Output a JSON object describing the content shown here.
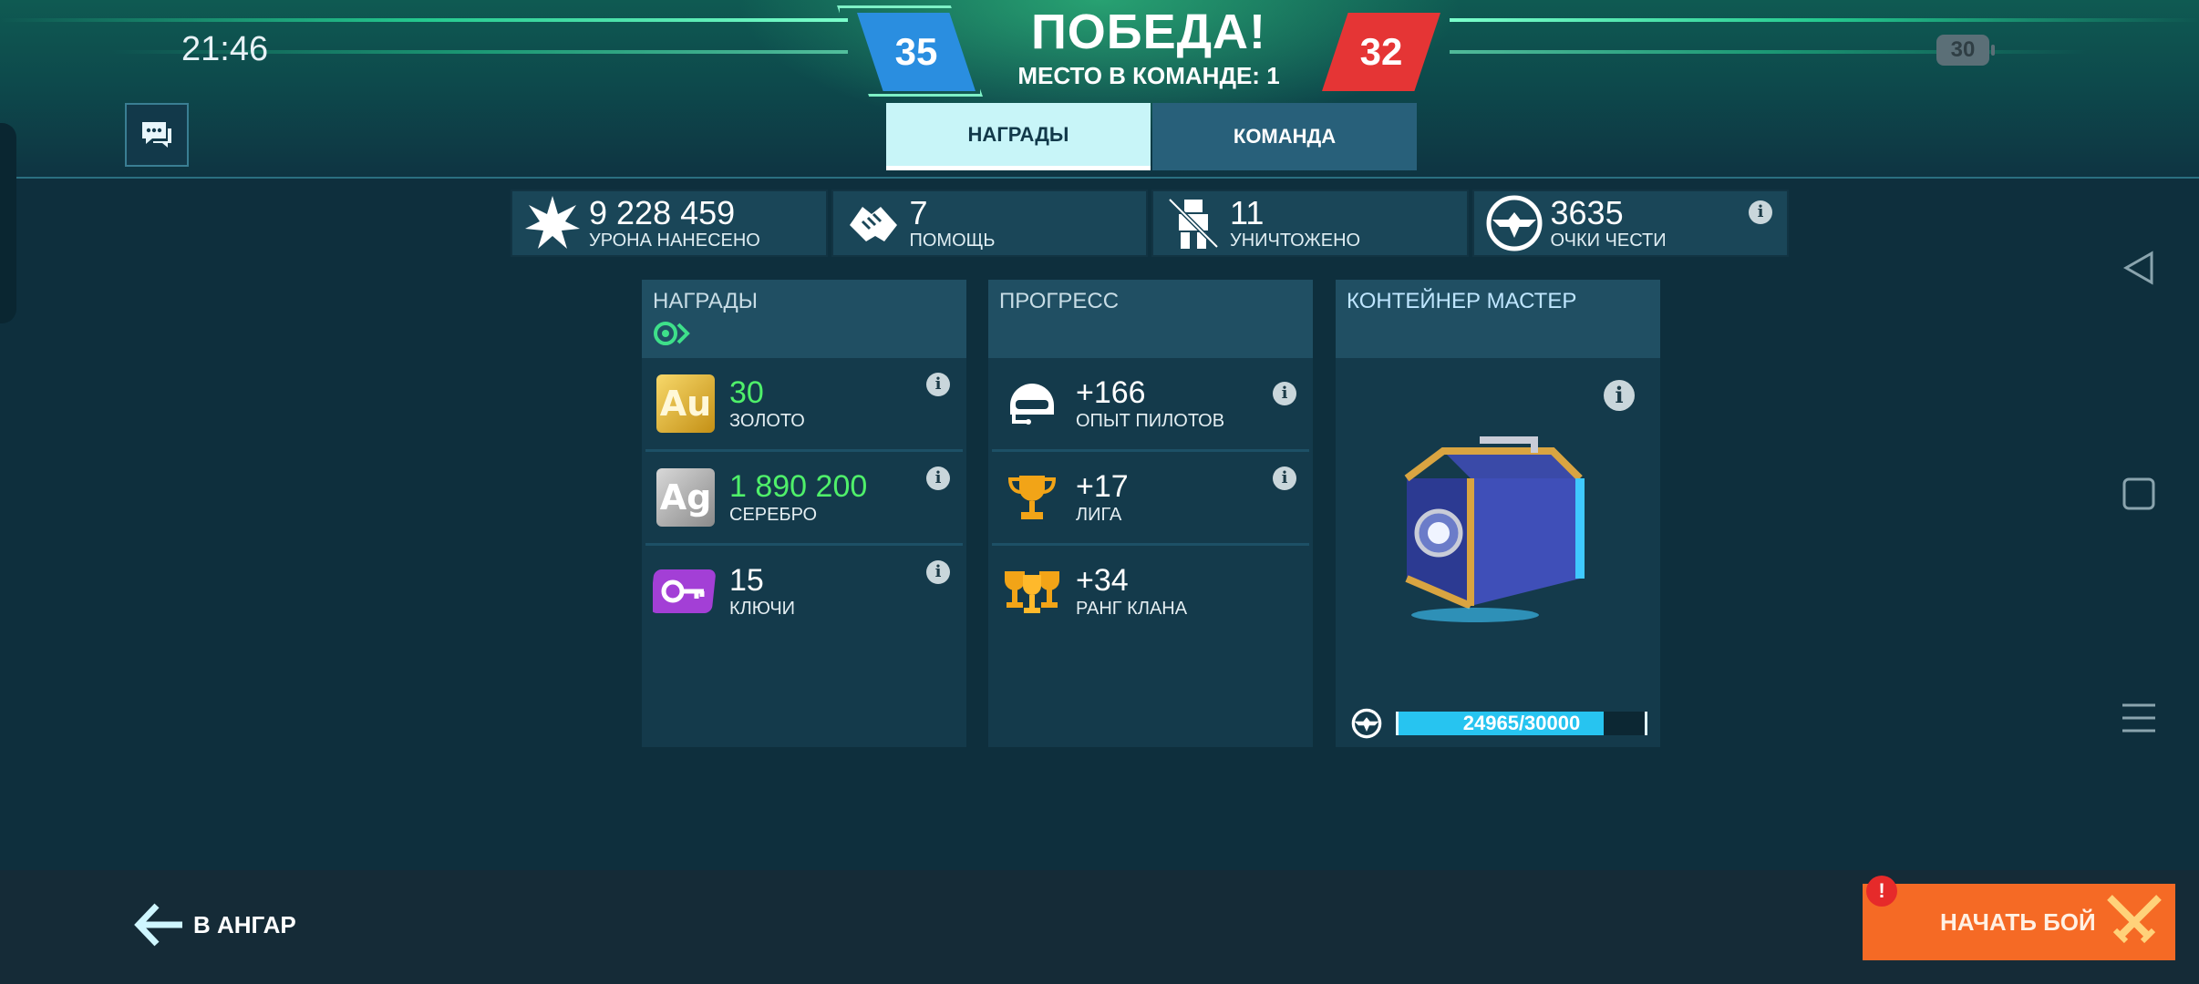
{
  "status_bar": {
    "time": "21:46",
    "battery": "30"
  },
  "header": {
    "title": "ПОБЕДА!",
    "subtitle": "МЕСТО В КОМАНДЕ: 1",
    "score_blue": "35",
    "score_red": "32",
    "colors": {
      "blue": "#2a8ee0",
      "red": "#e53535"
    }
  },
  "tabs": [
    {
      "label": "НАГРАДЫ",
      "active": true
    },
    {
      "label": "КОМАНДА",
      "active": false
    }
  ],
  "stats": [
    {
      "value": "9 228 459",
      "label": "УРОНА НАНЕСЕНО",
      "icon": "burst-icon"
    },
    {
      "value": "7",
      "label": "ПОМОЩЬ",
      "icon": "handshake-icon"
    },
    {
      "value": "11",
      "label": "УНИЧТОЖЕНО",
      "icon": "destroyed-robot-icon"
    },
    {
      "value": "3635",
      "label": "ОЧКИ ЧЕСТИ",
      "icon": "honor-emblem-icon"
    }
  ],
  "rewards_panel": {
    "title": "НАГРАДЫ",
    "items": [
      {
        "value": "30",
        "label": "ЗОЛОТО",
        "tile": "Au"
      },
      {
        "value": "1 890 200",
        "label": "СЕРЕБРО",
        "tile": "Ag"
      },
      {
        "value": "15",
        "label": "КЛЮЧИ",
        "icon": "key-card-icon"
      }
    ]
  },
  "progress_panel": {
    "title": "ПРОГРЕСС",
    "items": [
      {
        "value": "+166",
        "label": "ОПЫТ ПИЛОТОВ",
        "icon": "pilot-helmet-icon"
      },
      {
        "value": "+17",
        "label": "ЛИГА",
        "icon": "trophy-icon"
      },
      {
        "value": "+34",
        "label": "РАНГ КЛАНА",
        "icon": "double-trophy-icon"
      }
    ]
  },
  "container_panel": {
    "title": "КОНТЕЙНЕР МАСТЕР",
    "progress_text": "24965/30000",
    "progress_fraction": 0.8322
  },
  "footer": {
    "back_label": "В АНГАР",
    "start_label": "НАЧАТЬ БОЙ",
    "alert": "!"
  },
  "info_glyph": "i"
}
